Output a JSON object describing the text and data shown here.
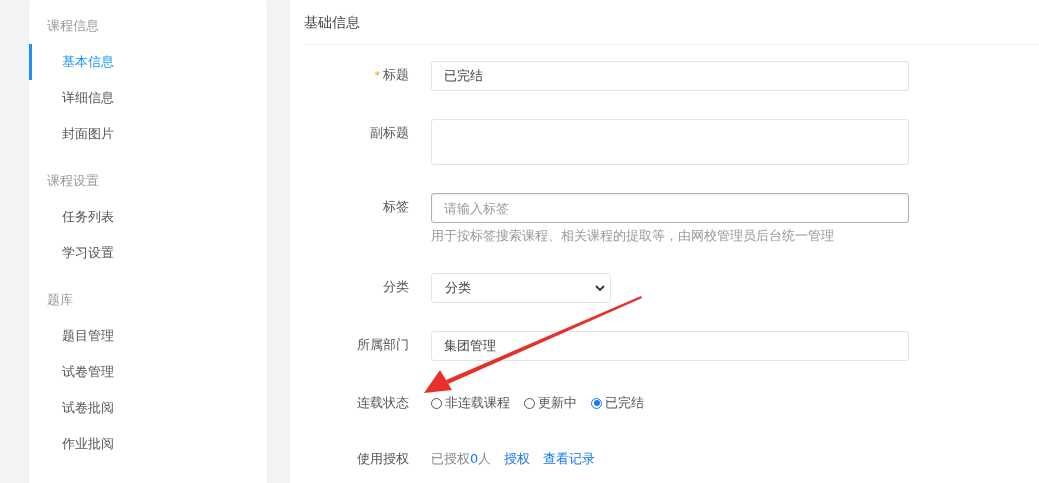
{
  "sidebar": {
    "groups": [
      {
        "heading": "课程信息",
        "items": [
          {
            "label": "基本信息",
            "selected": true
          },
          {
            "label": "详细信息",
            "selected": false
          },
          {
            "label": "封面图片",
            "selected": false
          }
        ]
      },
      {
        "heading": "课程设置",
        "items": [
          {
            "label": "任务列表",
            "selected": false
          },
          {
            "label": "学习设置",
            "selected": false
          }
        ]
      },
      {
        "heading": "题库",
        "items": [
          {
            "label": "题目管理",
            "selected": false
          },
          {
            "label": "试卷管理",
            "selected": false
          },
          {
            "label": "试卷批阅",
            "selected": false
          },
          {
            "label": "作业批阅",
            "selected": false
          }
        ]
      }
    ]
  },
  "panel": {
    "title": "基础信息",
    "fields": [
      {
        "kind": "input",
        "label": "标题",
        "required_mark": "*",
        "value": "已完结"
      },
      {
        "kind": "textarea",
        "label": "副标题"
      },
      {
        "kind": "input",
        "label": "标签",
        "placeholder": "请输入标签",
        "focused": true,
        "help": "用于按标签搜索课程、相关课程的提取等，由网校管理员后台统一管理"
      },
      {
        "kind": "select",
        "label": "分类",
        "value": "分类"
      },
      {
        "kind": "input",
        "label": "所属部门",
        "value": "集团管理"
      },
      {
        "kind": "radio",
        "label": "连载状态",
        "options": [
          {
            "label": "非连载课程",
            "selected": false
          },
          {
            "label": "更新中",
            "selected": false
          },
          {
            "label": "已完结",
            "selected": true
          }
        ]
      },
      {
        "kind": "auth",
        "label": "使用授权",
        "prefix": "已授权",
        "count": "0",
        "suffix": "人",
        "links": [
          "授权",
          "查看记录"
        ]
      }
    ]
  }
}
